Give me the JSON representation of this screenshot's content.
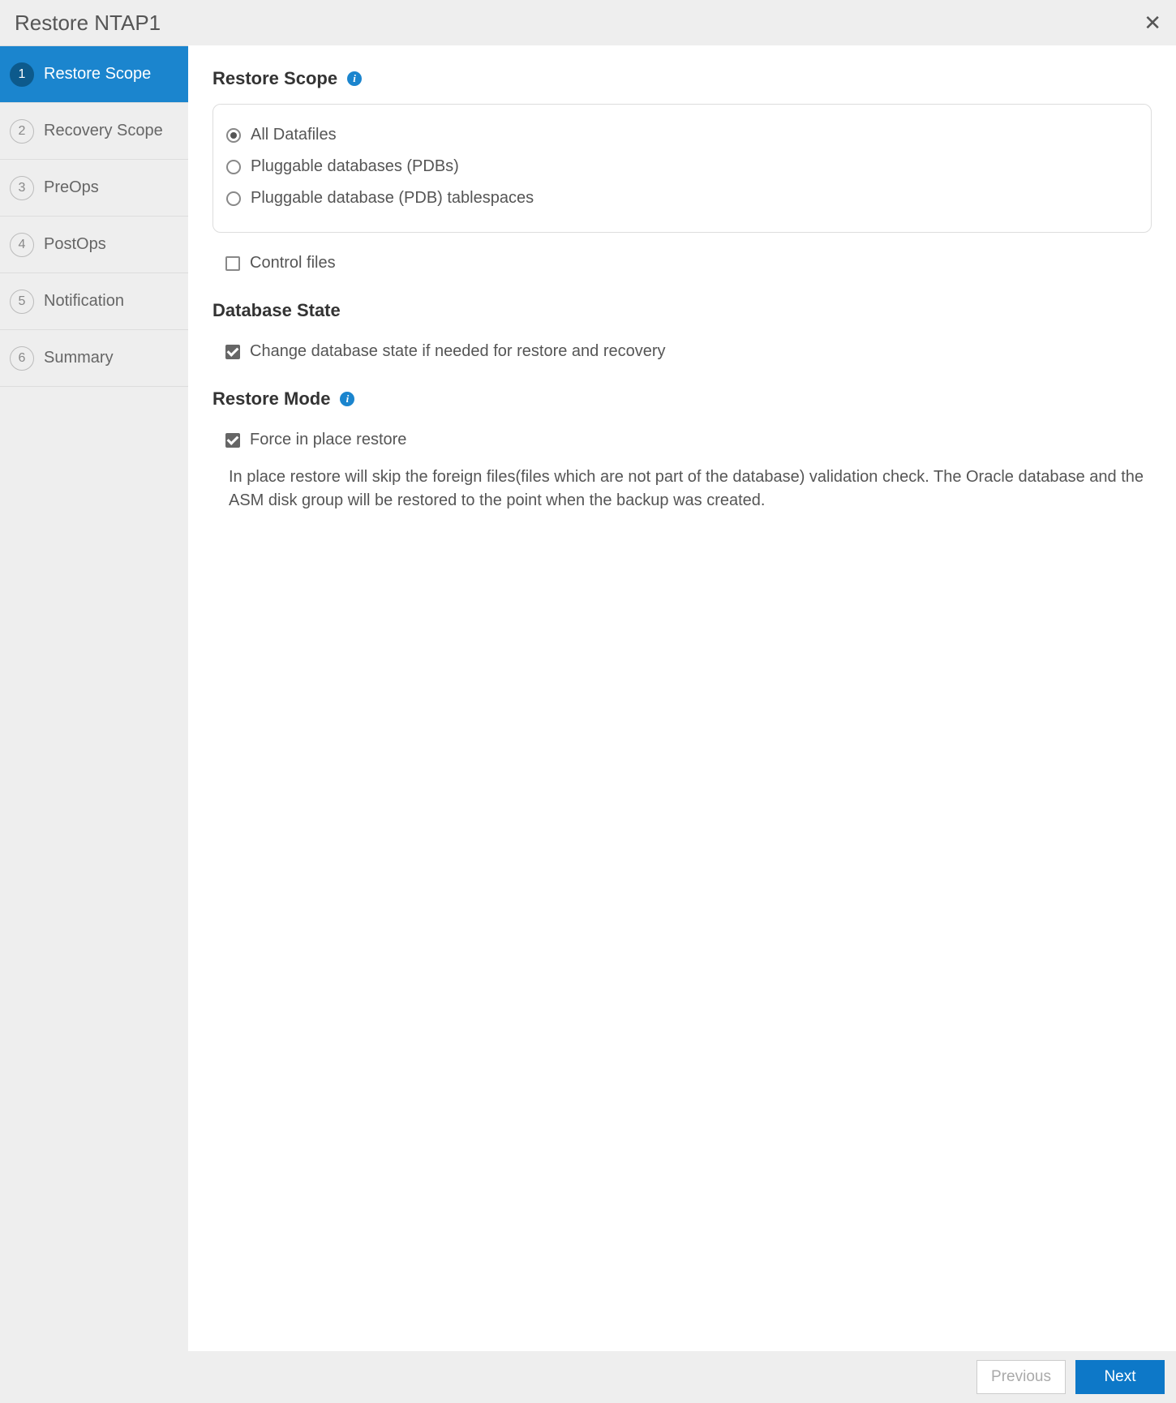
{
  "header": {
    "title": "Restore NTAP1"
  },
  "sidebar": {
    "steps": [
      {
        "num": "1",
        "label": "Restore Scope",
        "active": true
      },
      {
        "num": "2",
        "label": "Recovery Scope",
        "active": false
      },
      {
        "num": "3",
        "label": "PreOps",
        "active": false
      },
      {
        "num": "4",
        "label": "PostOps",
        "active": false
      },
      {
        "num": "5",
        "label": "Notification",
        "active": false
      },
      {
        "num": "6",
        "label": "Summary",
        "active": false
      }
    ]
  },
  "restoreScope": {
    "title": "Restore Scope",
    "options": {
      "allDatafiles": "All Datafiles",
      "pdbs": "Pluggable databases (PDBs)",
      "pdbTablespaces": "Pluggable database (PDB) tablespaces"
    },
    "controlFiles": "Control files"
  },
  "databaseState": {
    "title": "Database State",
    "changeStateLabel": "Change database state if needed for restore and recovery"
  },
  "restoreMode": {
    "title": "Restore Mode",
    "forceInPlaceLabel": "Force in place restore",
    "description": "In place restore will skip the foreign files(files which are not part of the database) validation check. The Oracle database and the ASM disk group will be restored to the point when the backup was created."
  },
  "footer": {
    "previous": "Previous",
    "next": "Next"
  }
}
